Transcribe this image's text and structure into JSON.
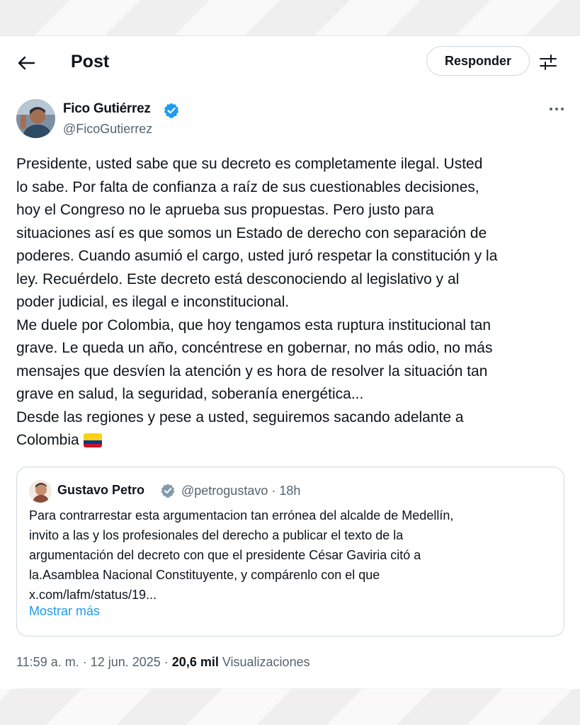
{
  "header": {
    "title": "Post",
    "reply_label": "Responder"
  },
  "author": {
    "name": "Fico Gutiérrez",
    "handle": "@FicoGutierrez"
  },
  "tweet": {
    "lines": [
      "Presidente, usted sabe que su decreto es completamente ilegal.  Usted",
      "lo sabe. Por falta de confianza a raíz de sus cuestionables decisiones,",
      "hoy el Congreso no le aprueba sus propuestas. Pero justo para",
      "situaciones así es que somos un Estado de derecho con separación de",
      "poderes. Cuando asumió el cargo, usted juró respetar la constitución y la",
      "ley. Recuérdelo. Este decreto está desconociendo al legislativo y al",
      "poder judicial, es ilegal e inconstitucional.",
      "Me duele por Colombia, que hoy tengamos esta ruptura institucional tan",
      "grave. Le queda un año, concéntrese en gobernar, no más odio, no más",
      "mensajes que desvíen la atención y es hora de resolver la situación tan",
      "grave en salud, la seguridad, soberanía energética...",
      "Desde las regiones y pese a usted, seguiremos sacando adelante a",
      "Colombia"
    ],
    "flag_icon": "colombia-flag"
  },
  "quote": {
    "name": "Gustavo Petro",
    "meta": "@petrogustavo · 18h",
    "lines": [
      "Para contrarrestar esta argumentacion tan errónea del alcalde de Medellín,",
      "invito a las y los profesionales del derecho a publicar el texto de la",
      "argumentación del decreto con que el presidente César Gaviria citó a",
      "la.Asamblea Nacional Constituyente, y compárenlo con el que",
      "x.com/lafm/status/19..."
    ],
    "show_more": "Mostrar más"
  },
  "footer": {
    "time_date": "11:59 a. m. · 12 jun. 2025 · ",
    "views_count": "20,6 mil",
    "views_label": " Visualizaciones"
  },
  "colors": {
    "link": "#1d9bf0",
    "secondary_text": "#536471",
    "verified": "#1d9bf0"
  }
}
